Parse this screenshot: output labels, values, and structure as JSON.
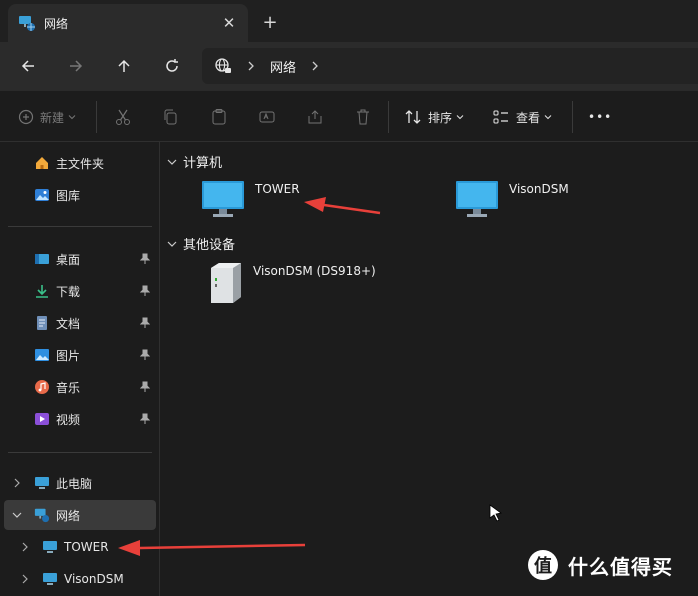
{
  "tab": {
    "title": "网络",
    "close": "✕",
    "new": "+"
  },
  "address": {
    "crumbs": [
      "网络"
    ]
  },
  "toolbar": {
    "new_label": "新建",
    "sort_label": "排序",
    "view_label": "查看",
    "more": "•••"
  },
  "sidebar": {
    "top": [
      {
        "label": "主文件夹"
      },
      {
        "label": "图库"
      }
    ],
    "quick": [
      {
        "label": "桌面"
      },
      {
        "label": "下载"
      },
      {
        "label": "文档"
      },
      {
        "label": "图片"
      },
      {
        "label": "音乐"
      },
      {
        "label": "视频"
      }
    ],
    "tree": [
      {
        "label": "此电脑"
      },
      {
        "label": "网络"
      },
      {
        "label": "TOWER"
      },
      {
        "label": "VisonDSM"
      }
    ]
  },
  "main": {
    "groups": [
      {
        "label": "计算机"
      },
      {
        "label": "其他设备"
      }
    ],
    "computers": [
      {
        "name": "TOWER"
      },
      {
        "name": "VisonDSM"
      }
    ],
    "devices": [
      {
        "name": "VisonDSM (DS918+)"
      }
    ]
  },
  "watermark": {
    "logo": "值",
    "text": "什么值得买"
  },
  "colors": {
    "arrow": "#e8403a",
    "accent": "#4cc2ff",
    "monitor": "#3aa0d8"
  }
}
